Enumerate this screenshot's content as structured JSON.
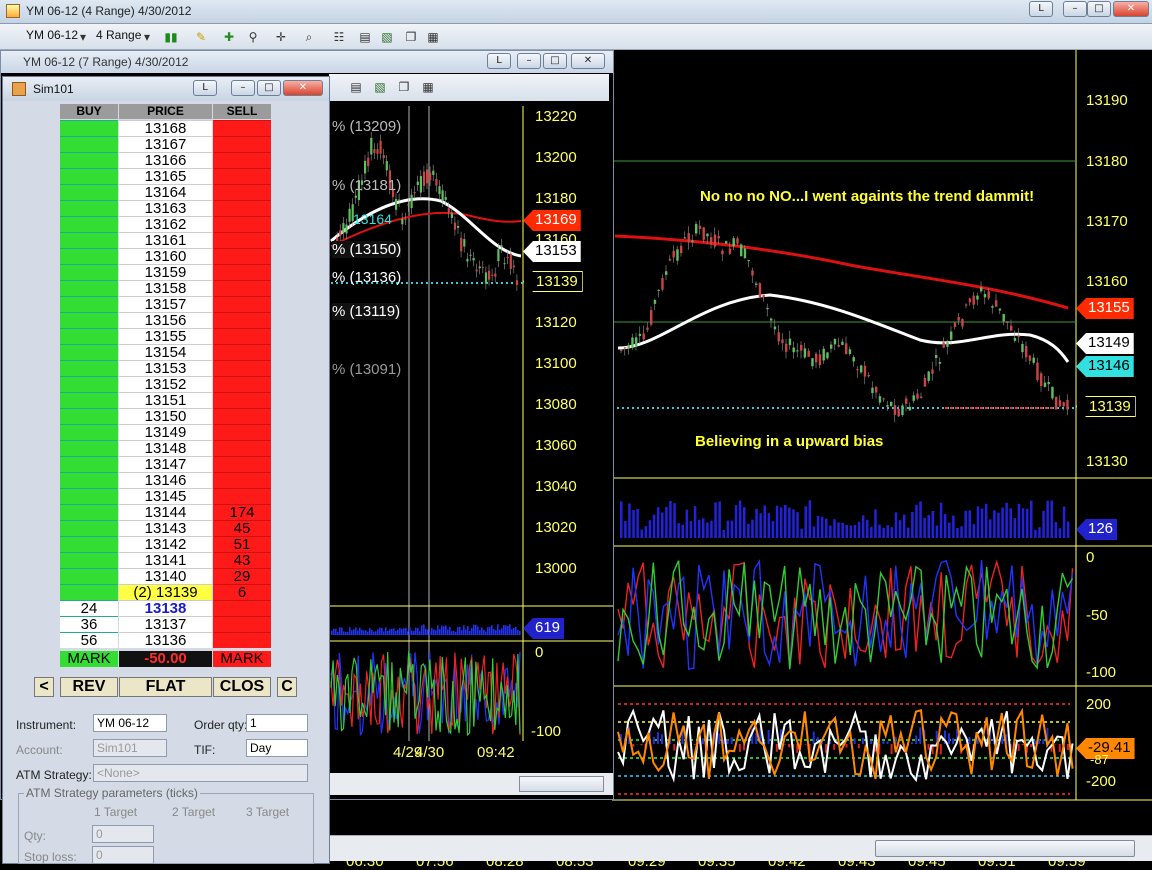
{
  "main_window": {
    "title": "YM 06-12 (4 Range)  4/30/2012"
  },
  "toolbar": {
    "instrument": "YM 06-12",
    "interval": "4 Range"
  },
  "window_controls": {
    "link": "L",
    "minimize": "–",
    "maximize": "□",
    "close": "✕"
  },
  "chart": {
    "y_ticks": [
      "13190",
      "13180",
      "13170",
      "13160",
      "13150",
      "13140",
      "13130"
    ],
    "x_ticks": [
      "09:29",
      "09:35",
      "09:42",
      "09:43",
      "09:45",
      "09:51",
      "09:59"
    ],
    "annotation_top": "No no no NO...I went againts the trend dammit!",
    "annotation_bottom": "Believing in a upward bias",
    "price_badges": [
      "13155",
      "13149",
      "13146",
      "13139"
    ],
    "volume_badge": "126",
    "osc1_ticks": [
      "0",
      "-50",
      "-100"
    ],
    "osc2_ticks": [
      "200",
      "-29.41",
      "-87",
      "-200"
    ]
  },
  "second_window": {
    "title": "YM 06-12 (7 Range)  4/30/2012",
    "y_ticks": [
      "13220",
      "13200",
      "13180",
      "13160",
      "13140",
      "13120",
      "13100",
      "13080",
      "13060",
      "13040",
      "13020",
      "13000"
    ],
    "badges": [
      "13169",
      "13153",
      "13139"
    ],
    "volume_badge": "619",
    "fib_labels": [
      "% (13209)",
      "% (13181)",
      "13164",
      "% (13150)",
      "% (13136)",
      "% (13119)",
      "% (13091)"
    ],
    "osc_ticks": [
      "0",
      "-100"
    ],
    "x_ticks": [
      "4/29",
      "4/30",
      "09:42"
    ],
    "bottom_x_ticks": [
      "06:30",
      "07:56",
      "08:28",
      "08:53"
    ]
  },
  "dom": {
    "title": "Sim101",
    "headers": {
      "buy": "BUY",
      "price": "PRICE",
      "sell": "SELL"
    },
    "prices": [
      "13168",
      "13167",
      "13166",
      "13165",
      "13164",
      "13163",
      "13162",
      "13161",
      "13160",
      "13159",
      "13158",
      "13157",
      "13156",
      "13155",
      "13154",
      "13153",
      "13152",
      "13151",
      "13150",
      "13149",
      "13148",
      "13147",
      "13146",
      "13145",
      "13144",
      "13143",
      "13142",
      "13141",
      "13140",
      "(2) 13139",
      "13138",
      "13137",
      "13136"
    ],
    "sell_sizes": [
      "",
      "",
      "",
      "",
      "",
      "",
      "",
      "",
      "",
      "",
      "",
      "",
      "",
      "",
      "",
      "",
      "",
      "",
      "",
      "",
      "",
      "",
      "",
      "",
      "174",
      "45",
      "51",
      "43",
      "29",
      "6",
      "",
      "",
      ""
    ],
    "buy_sizes": [
      "",
      "",
      "",
      "",
      "",
      "",
      "",
      "",
      "",
      "",
      "",
      "",
      "",
      "",
      "",
      "",
      "",
      "",
      "",
      "",
      "",
      "",
      "",
      "",
      "",
      "",
      "",
      "",
      "",
      "",
      "24",
      "36",
      "56"
    ],
    "mark_buy": "MARK",
    "pnl": "-50.00",
    "mark_sell": "MARK",
    "buttons": {
      "left": "<",
      "rev": "REV",
      "flat": "FLAT",
      "close": "CLOS",
      "c": "C"
    },
    "form": {
      "instrument_label": "Instrument:",
      "instrument_value": "YM 06-12",
      "order_qty_label": "Order qty:",
      "order_qty_value": "1",
      "account_label": "Account:",
      "account_value": "Sim101",
      "tif_label": "TIF:",
      "tif_value": "Day",
      "atm_label": "ATM Strategy:",
      "atm_value": "<None>",
      "atm_params_label": "ATM Strategy parameters (ticks)",
      "targets": [
        "1 Target",
        "2 Target",
        "3 Target"
      ],
      "qty_label": "Qty:",
      "qty_value": "0",
      "stop_label": "Stop loss:",
      "stop_value": "0"
    }
  },
  "colors": {
    "buy": "#33dd33",
    "sell": "#ff1a1a",
    "axis": "#ffff66",
    "ask_badge": "#ff2a00",
    "bid_badge": "#ffffff",
    "cyan_badge": "#33e0e0",
    "volume_badge": "#2222cc"
  }
}
